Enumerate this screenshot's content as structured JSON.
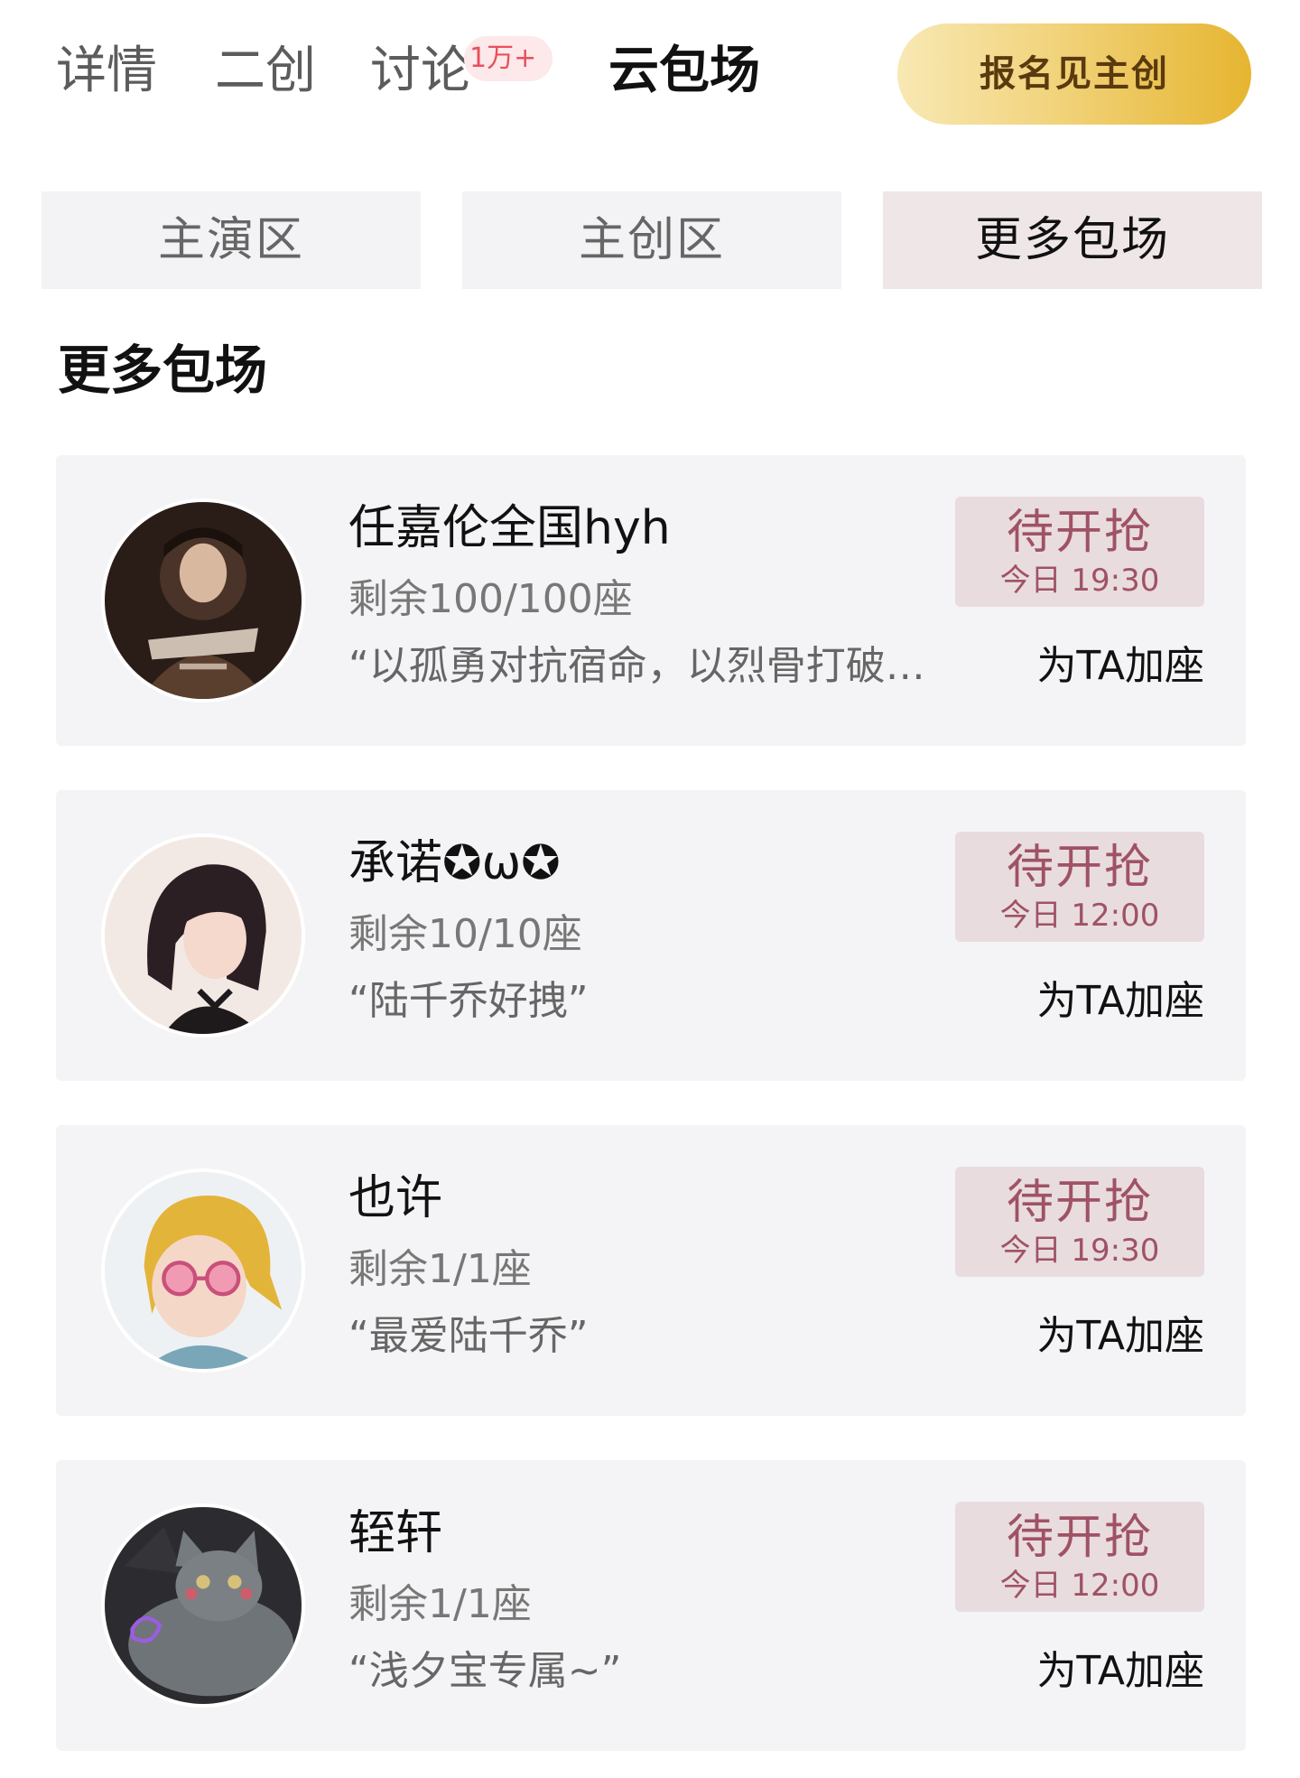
{
  "nav": {
    "tabs": [
      {
        "label": "详情"
      },
      {
        "label": "二创"
      },
      {
        "label": "讨论"
      },
      {
        "label": "云包场"
      }
    ],
    "discussion_badge": "1万+",
    "signup_label": "报名见主创"
  },
  "zones": {
    "tabs": [
      {
        "label": "主演区"
      },
      {
        "label": "主创区"
      },
      {
        "label": "更多包场"
      }
    ],
    "active_index": 2
  },
  "section": {
    "title": "更多包场"
  },
  "cards": [
    {
      "name": "任嘉伦全国hyh",
      "seats": "剩余100/100座",
      "quote": "“以孤勇对抗宿命，以烈骨打破…",
      "status": "待开抢",
      "time": "今日 19:30",
      "action": "为TA加座"
    },
    {
      "name": "承诺✪ω✪",
      "seats": "剩余10/10座",
      "quote": "“陆千乔好拽”",
      "status": "待开抢",
      "time": "今日 12:00",
      "action": "为TA加座"
    },
    {
      "name": "也许",
      "seats": "剩余1/1座",
      "quote": "“最爱陆千乔”",
      "status": "待开抢",
      "time": "今日 19:30",
      "action": "为TA加座"
    },
    {
      "name": "轾轩",
      "seats": "剩余1/1座",
      "quote": "“浅夕宝专属~”",
      "status": "待开抢",
      "time": "今日 12:00",
      "action": "为TA加座"
    }
  ],
  "colors": {
    "accent": "#a05265",
    "status_bg": "#e8dcdf",
    "card_bg": "#f4f4f6",
    "badge_text": "#e8505b",
    "signup_gold": "#e6b531"
  }
}
